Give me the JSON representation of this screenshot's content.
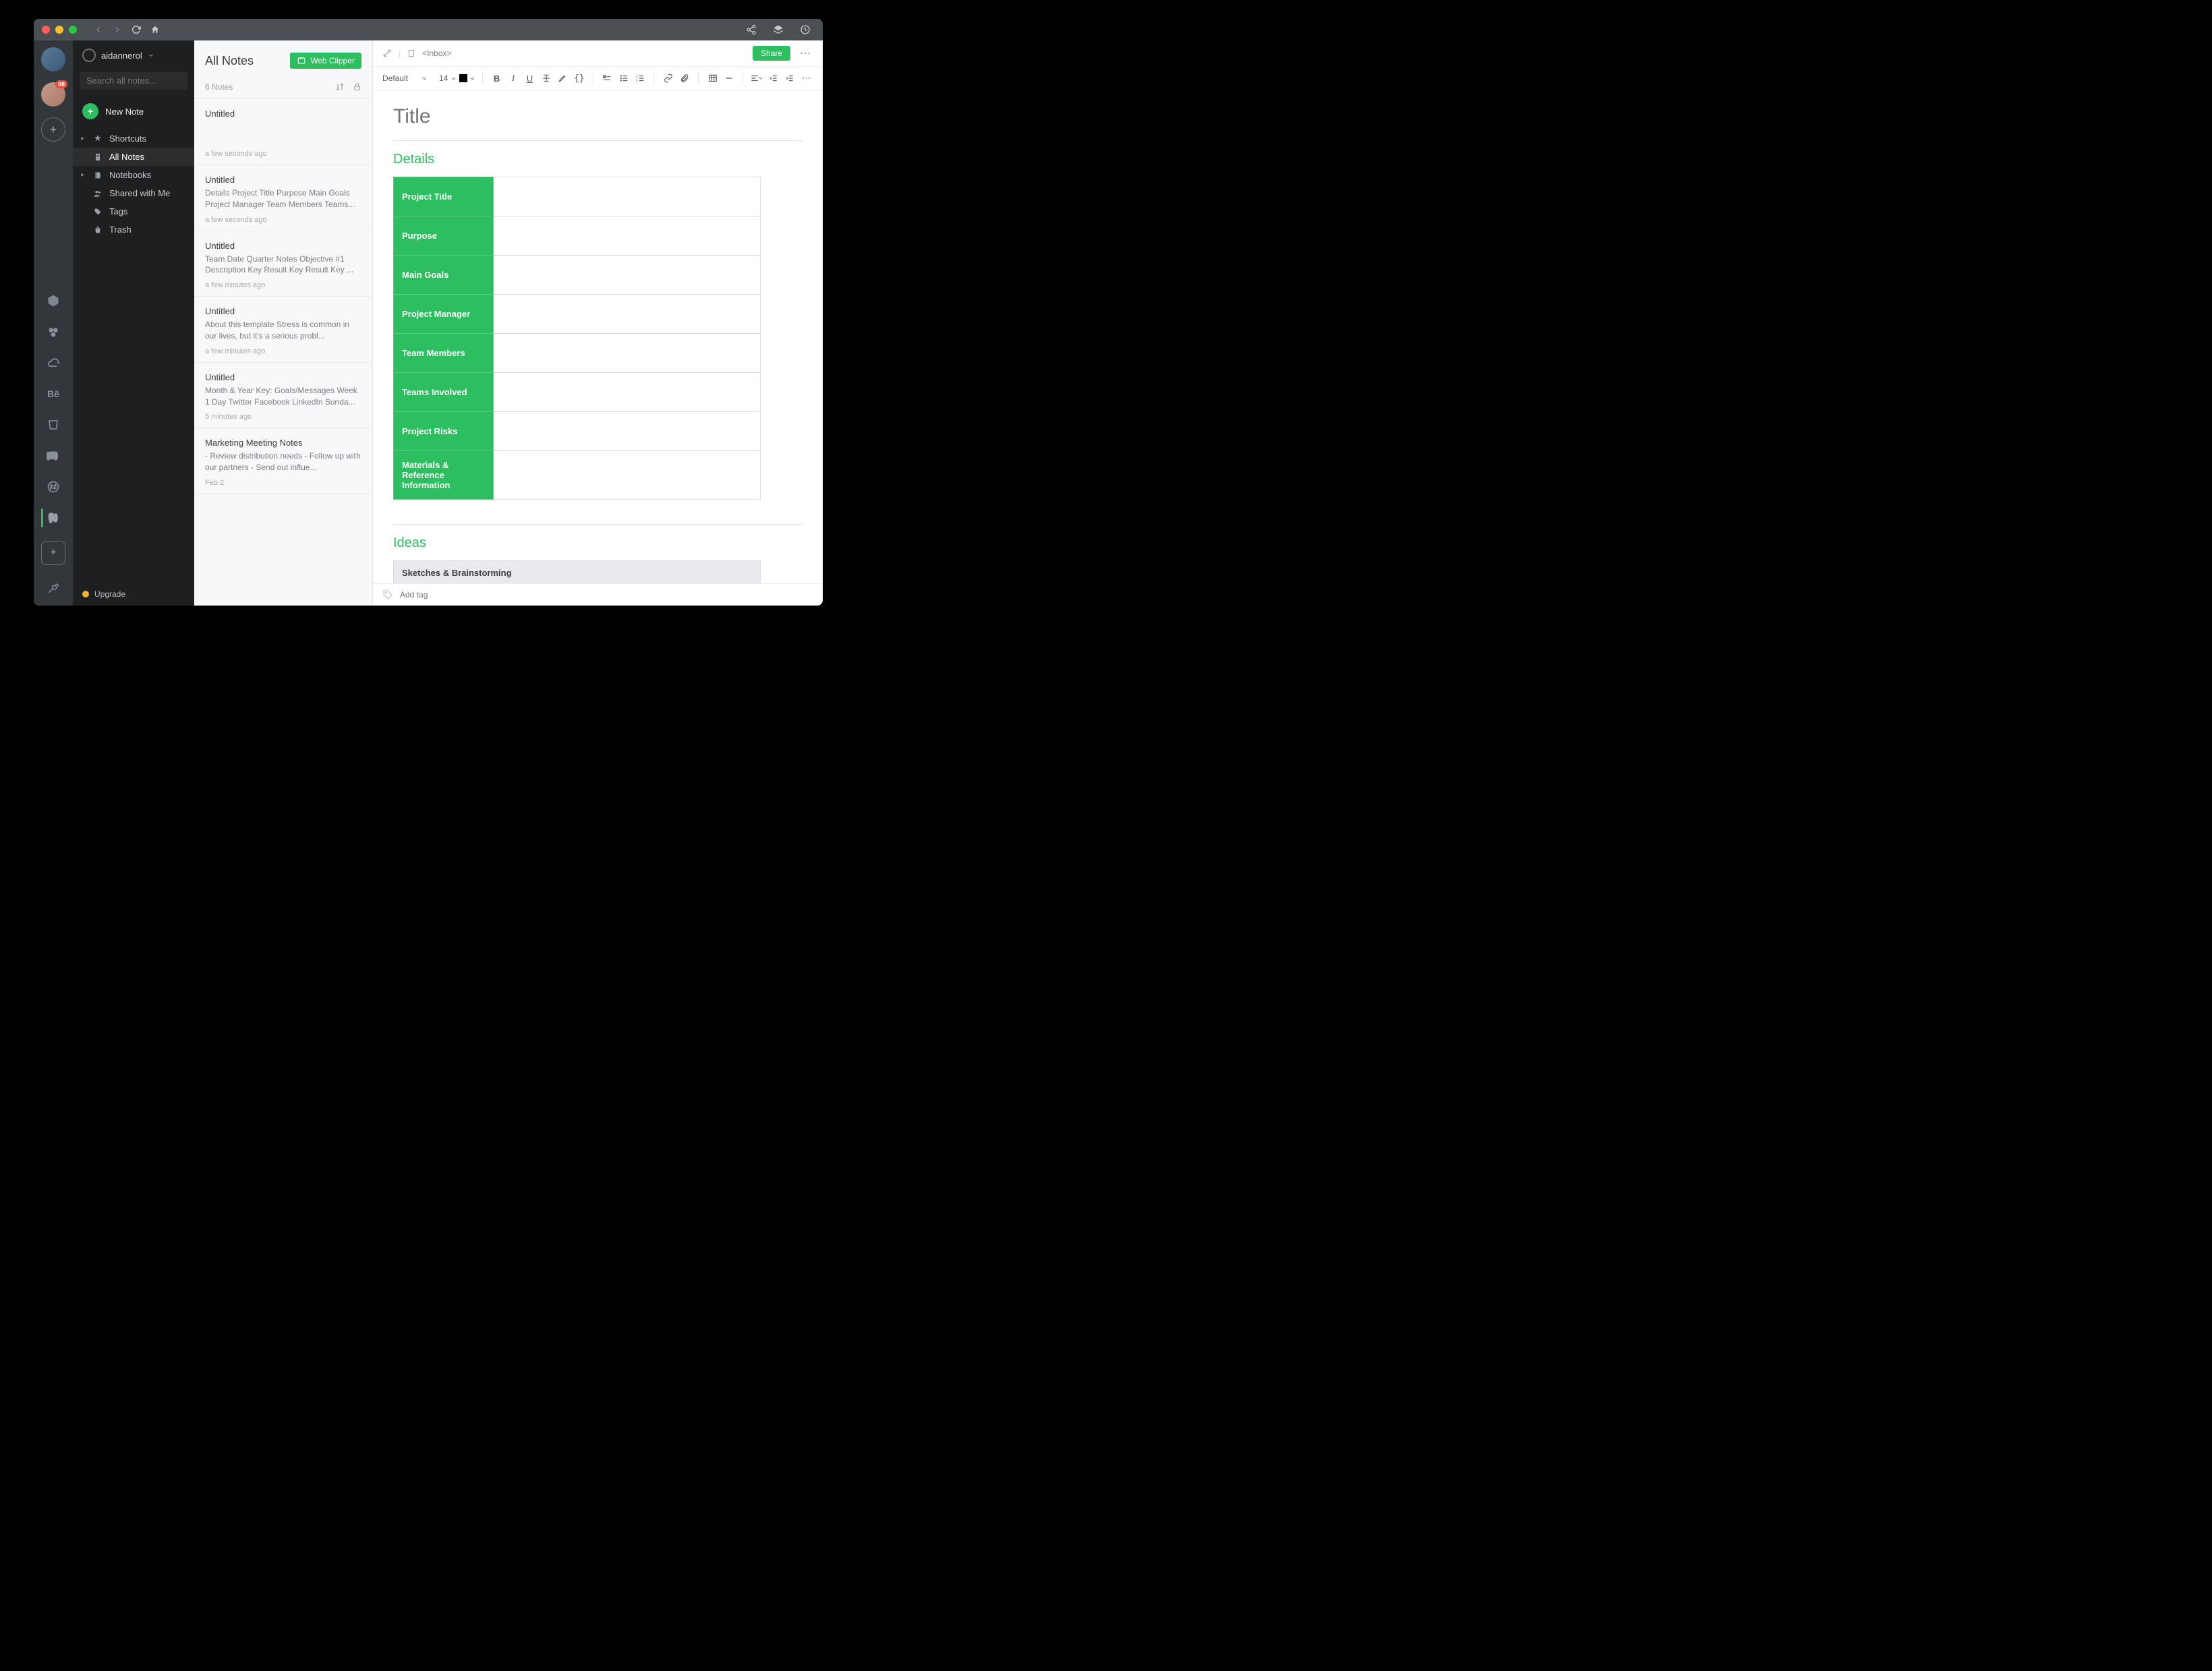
{
  "titlebar": {},
  "rail": {
    "badge": "98"
  },
  "sidebar": {
    "user": "aidannerol",
    "search_ph": "Search all notes...",
    "newnote": "New Note",
    "items": [
      {
        "label": "Shortcuts"
      },
      {
        "label": "All Notes"
      },
      {
        "label": "Notebooks"
      },
      {
        "label": "Shared with Me"
      },
      {
        "label": "Tags"
      },
      {
        "label": "Trash"
      }
    ],
    "upgrade": "Upgrade"
  },
  "notelist": {
    "heading": "All Notes",
    "webclipper": "Web Clipper",
    "count": "6 Notes",
    "notes": [
      {
        "title": "Untitled",
        "preview": "",
        "time": "a few seconds ago"
      },
      {
        "title": "Untitled",
        "preview": "Details Project Title Purpose Main Goals Project Manager Team Members Teams...",
        "time": "a few seconds ago"
      },
      {
        "title": "Untitled",
        "preview": "Team Date Quarter Notes Objective #1 Description Key Result Key Result Key ...",
        "time": "a few minutes ago"
      },
      {
        "title": "Untitled",
        "preview": "About this template Stress is common in our lives, but it's a serious probl...",
        "time": "a few minutes ago"
      },
      {
        "title": "Untitled",
        "preview": "Month & Year Key: Goals/Messages Week 1 Day Twitter Facebook LinkedIn Sunda...",
        "time": "5 minutes ago"
      },
      {
        "title": "Marketing Meeting Notes",
        "preview": "- Review distribution needs - Follow up with our partners - Send out influe...",
        "time": "Feb 2"
      }
    ]
  },
  "editor": {
    "notebook": "Inbox",
    "share": "Share",
    "font": "Default",
    "size": "14",
    "title_ph": "Title",
    "sections": {
      "details": "Details",
      "ideas": "Ideas"
    },
    "details_rows": [
      "Project Title",
      "Purpose",
      "Main Goals",
      "Project Manager",
      "Team Members",
      "Teams Involved",
      "Project Risks",
      "Materials & Reference Information"
    ],
    "ideas_header": "Sketches & Brainstorming",
    "addtag_ph": "Add tag"
  }
}
